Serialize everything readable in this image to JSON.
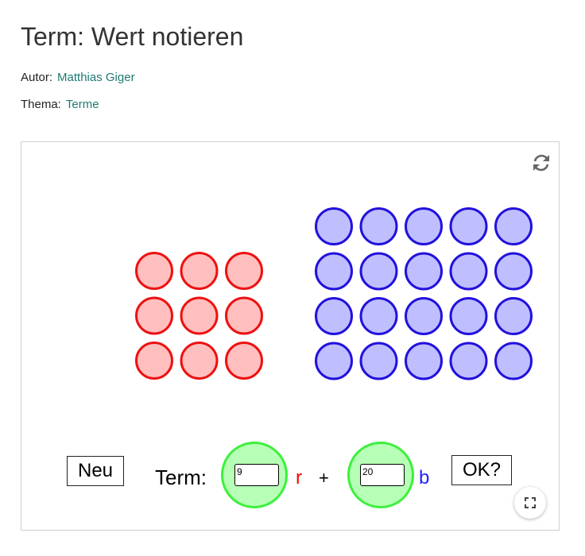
{
  "header": {
    "title": "Term: Wert notieren",
    "author_label": "Autor:",
    "author_name": "Matthias Giger",
    "topic_label": "Thema:",
    "topic_name": "Terme"
  },
  "applet": {
    "red_counters": {
      "rows": 3,
      "cols": 3,
      "count": 9,
      "fill": "#ffbfbf",
      "stroke": "#ee1111"
    },
    "blue_counters": {
      "rows": 4,
      "cols": 5,
      "count": 20,
      "fill": "#bfbfff",
      "stroke": "#2211dd"
    },
    "new_button_label": "Neu",
    "term_label": "Term:",
    "input_r_value": "9",
    "var_r": "r",
    "plus": "+",
    "input_b_value": "20",
    "var_b": "b",
    "ok_button_label": "OK?",
    "icons": {
      "reset": "refresh-icon",
      "fullscreen": "fullscreen-icon"
    },
    "colors": {
      "answer_fill": "#b7ffb7",
      "answer_stroke": "#3cf03c",
      "var_r": "#ff0000",
      "var_b": "#2222ff"
    }
  }
}
